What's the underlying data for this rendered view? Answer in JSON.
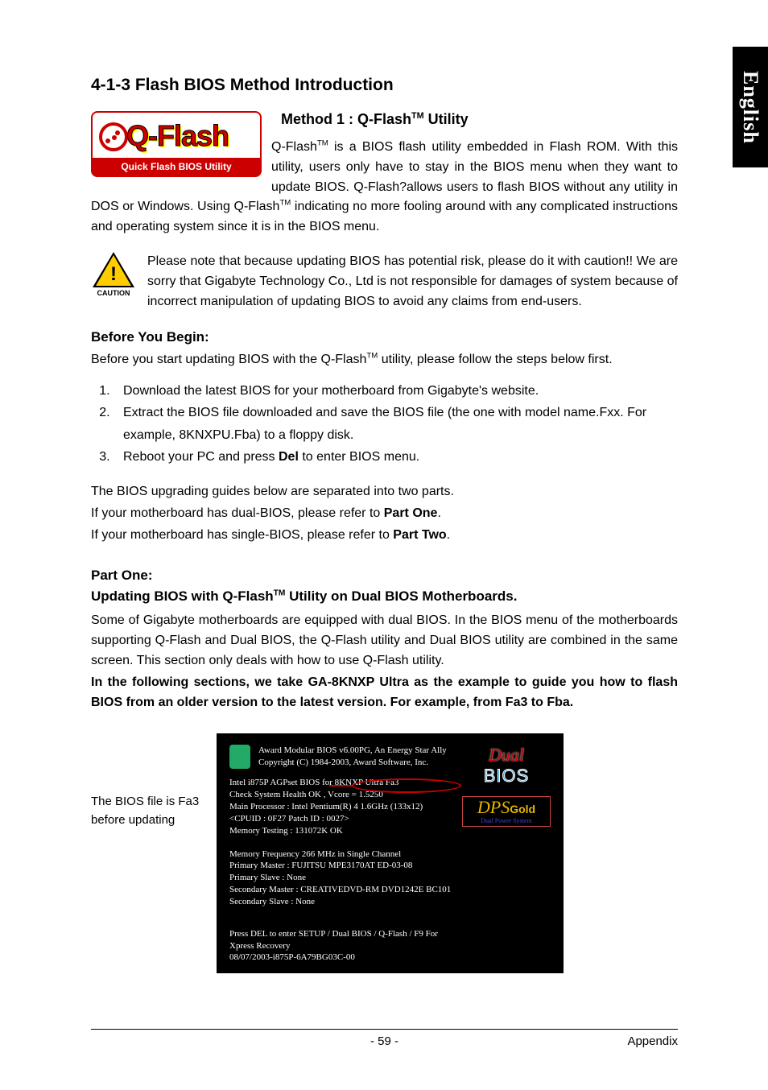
{
  "side_tab": "English",
  "section_title": "4-1-3   Flash BIOS Method Introduction",
  "qflash_logo": {
    "word": "Q-Flash",
    "sub": "Quick Flash BIOS Utility"
  },
  "method1": {
    "title_pre": "Method 1 : Q-Flash",
    "title_post": " Utility",
    "body_pre": "Q-Flash",
    "body_mid": " is a BIOS flash utility embedded in Flash ROM. With this utility, users only have to stay in the BIOS menu when they want to update BIOS. Q-Flash?allows users to flash BIOS without any utility in DOS or Windows. Using Q-Flash",
    "body_post": " indicating no more fooling around with any complicated instructions and operating system since it is in the BIOS menu."
  },
  "caution": {
    "label": "CAUTION",
    "text": "Please note that because updating BIOS has potential risk, please do it with caution!! We are sorry that Gigabyte Technology Co., Ltd is not responsible for damages of system because of incorrect manipulation of updating BIOS to avoid any claims from end-users."
  },
  "before": {
    "heading": "Before You Begin:",
    "intro_pre": "Before you start updating BIOS with the Q-Flash",
    "intro_post": " utility, please follow the steps below first.",
    "steps": [
      "Download the latest BIOS for your motherboard from Gigabyte's website.",
      "Extract the BIOS file downloaded and save the BIOS file (the one with model name.Fxx. For example, 8KNXPU.Fba) to a floppy disk.",
      {
        "pre": "Reboot your PC and press ",
        "bold": "Del",
        "post": " to enter BIOS menu."
      }
    ]
  },
  "guides": {
    "l1": "The BIOS upgrading guides below are separated into two parts.",
    "l2_pre": "If your motherboard has dual-BIOS, please refer to ",
    "l2_bold": "Part One",
    "l2_post": ".",
    "l3_pre": "If your motherboard has single-BIOS, please refer to ",
    "l3_bold": "Part Two",
    "l3_post": "."
  },
  "partone": {
    "heading": "Part One:",
    "sub_pre": "Updating BIOS with Q-Flash",
    "sub_post": " Utility on Dual BIOS Motherboards.",
    "p1": "Some of Gigabyte motherboards are equipped with dual BIOS. In the BIOS menu of the motherboards supporting Q-Flash and Dual BIOS, the Q-Flash utility and Dual BIOS utility are combined in the same screen. This section only deals with how to use Q-Flash utility.",
    "p2": "In the following sections, we take GA-8KNXP Ultra as the example to guide you how to flash BIOS from an older version to the latest version. For example, from Fa3 to Fba."
  },
  "bios": {
    "caption": "The BIOS file is Fa3 before updating",
    "hdr1": "Award Modular BIOS v6.00PG, An Energy Star Ally",
    "hdr2": "Copyright (C) 1984-2003, Award Software, Inc.",
    "s1": "Intel i875P AGPset BIOS for 8KNXP Ultra Fa3",
    "s2": "Check System Health OK , Vcore = 1.5250",
    "s3": "Main Processor : Intel Pentium(R) 4  1.6GHz (133x12)",
    "s4": "<CPUID : 0F27 Patch ID  : 0027>",
    "s5": "Memory Testing  : 131072K OK",
    "d1": "Memory Frequency 266 MHz in Single Channel",
    "d2": "Primary Master : FUJITSU MPE3170AT ED-03-08",
    "d3": "Primary Slave : None",
    "d4": "Secondary Master : CREATIVEDVD-RM DVD1242E BC101",
    "d5": "Secondary Slave : None",
    "f1": "Press DEL to enter SETUP / Dual BIOS / Q-Flash / F9 For Xpress Recovery",
    "f2": "08/07/2003-i875P-6A79BG03C-00",
    "logo_dual": "Dual",
    "logo_bios": "BIOS",
    "logo_dps": "DPS",
    "logo_gold": "Gold",
    "logo_sub": "Dual Power System"
  },
  "footer": {
    "page": "- 59 -",
    "right": "Appendix"
  },
  "tm": "TM"
}
